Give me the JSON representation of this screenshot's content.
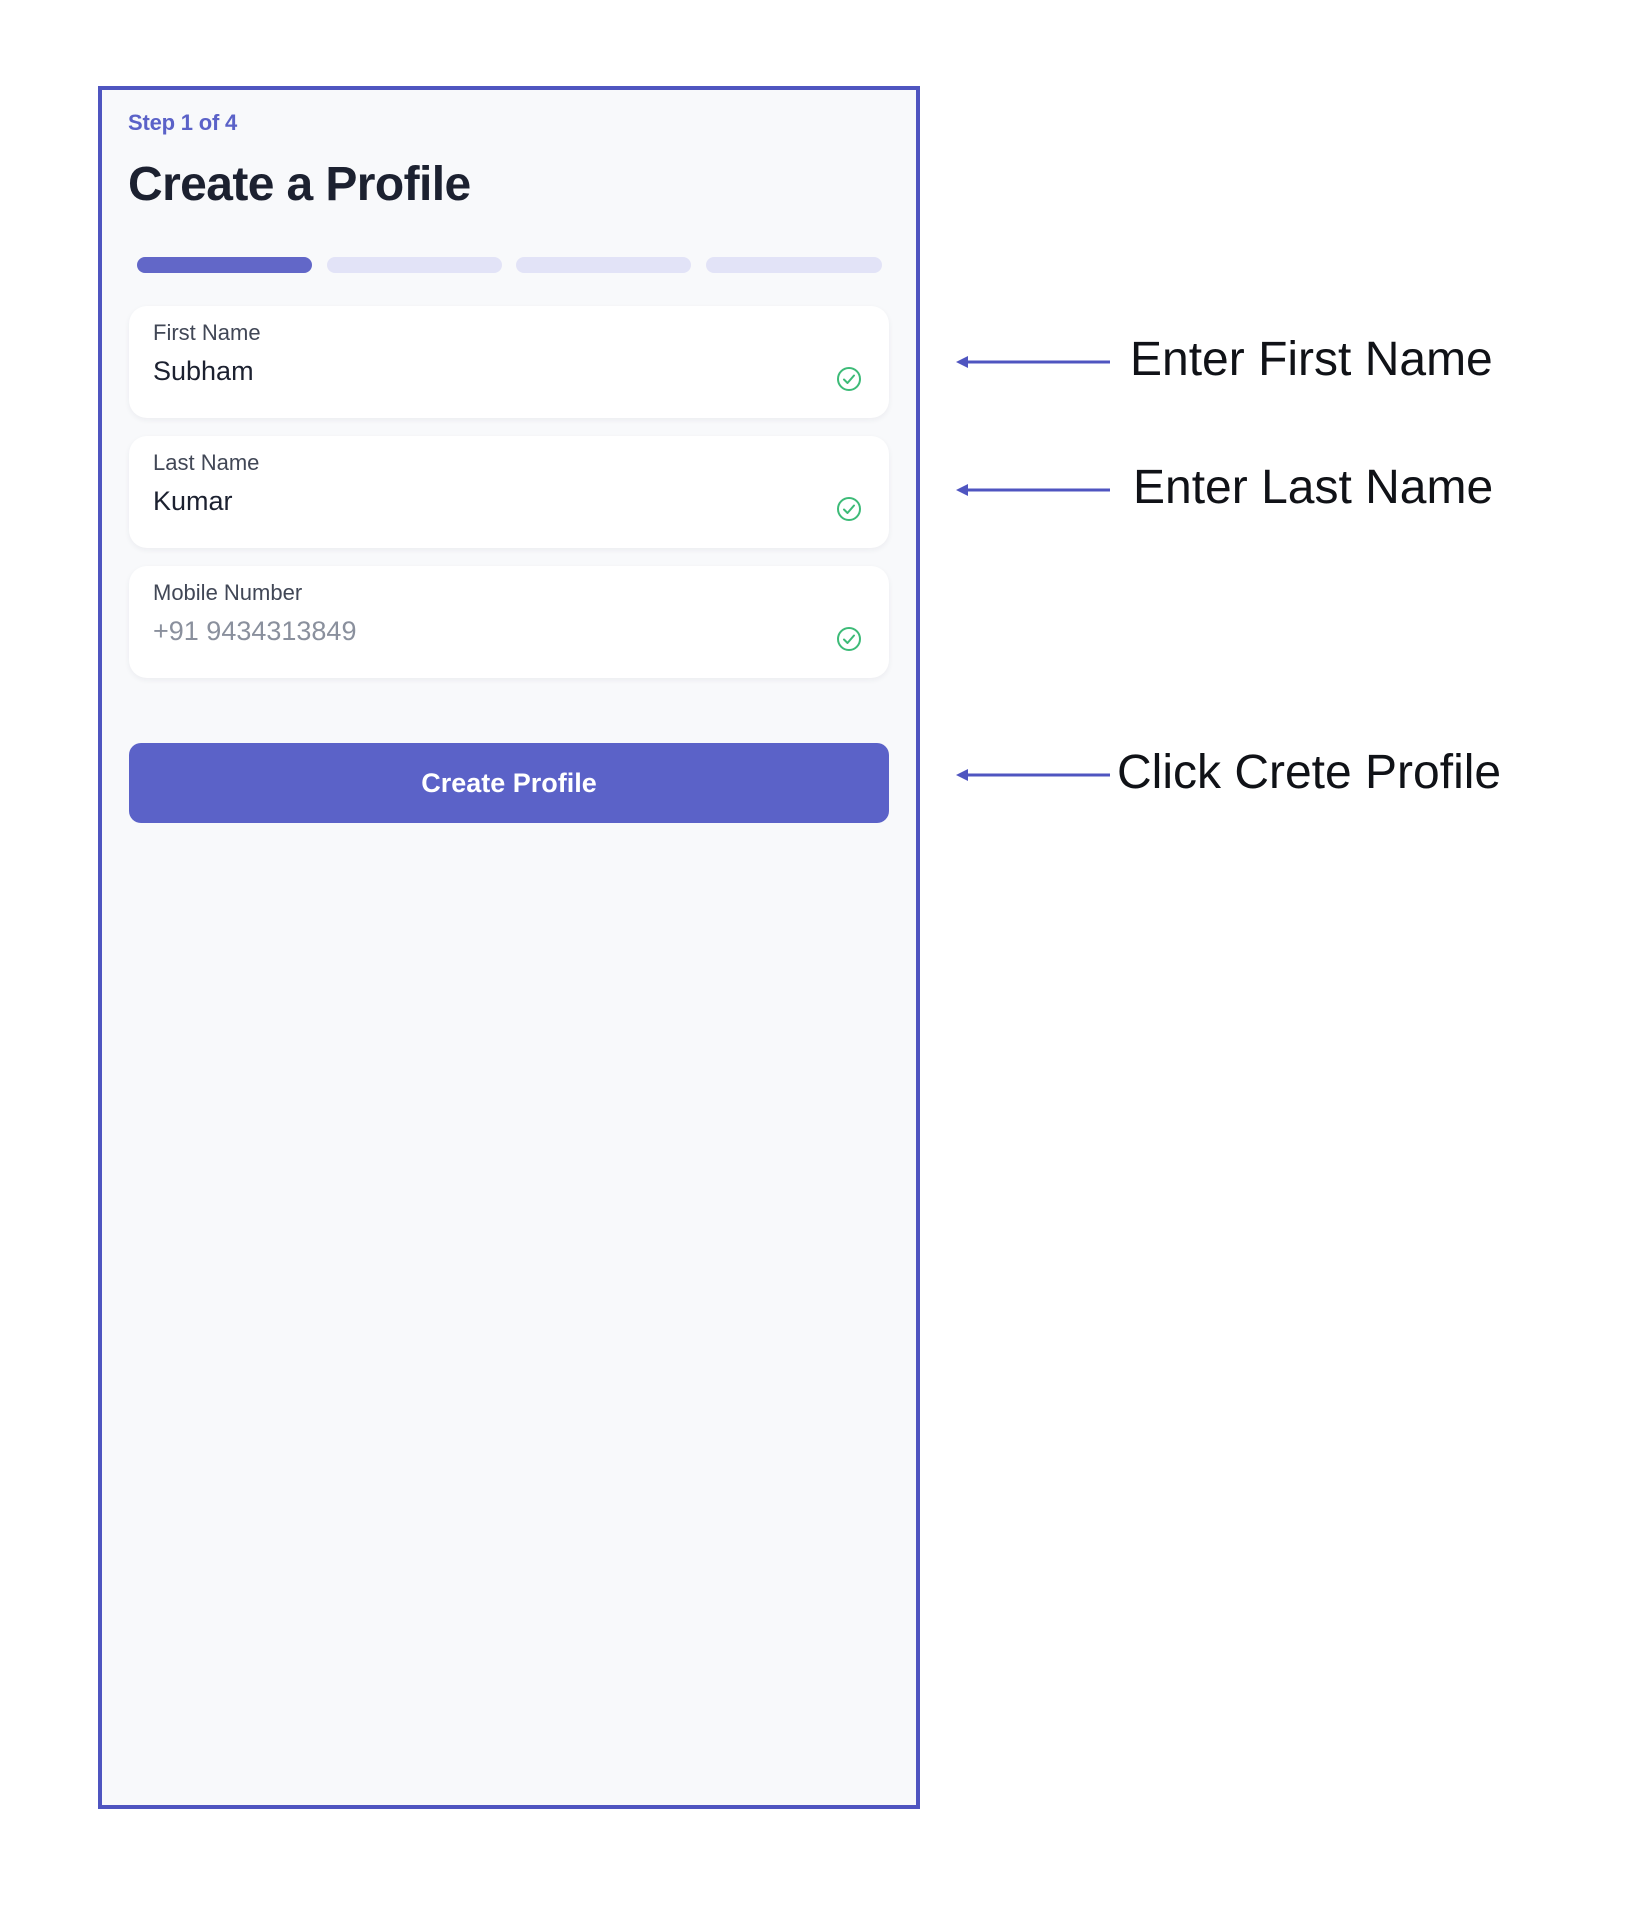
{
  "app": {
    "step_indicator": "Step 1 of 4",
    "title": "Create a Profile",
    "progress": {
      "current_step": 1,
      "total_steps": 4
    },
    "fields": [
      {
        "label": "First Name",
        "value": "Subham",
        "status_icon": "check-circle-icon"
      },
      {
        "label": "Last Name",
        "value": "Kumar",
        "status_icon": "check-circle-icon"
      },
      {
        "label": "Mobile Number",
        "value": "+91 9434313849",
        "status_icon": "check-circle-icon"
      }
    ],
    "create_button_label": "Create Profile"
  },
  "annotations": [
    {
      "text": "Enter First Name",
      "icon": "arrow-left-icon"
    },
    {
      "text": "Enter Last Name",
      "icon": "arrow-left-icon"
    },
    {
      "text": "Click Crete Profile",
      "icon": "arrow-left-icon"
    }
  ],
  "colors": {
    "accent": "#5b62c8",
    "frame_border": "#4f55c0",
    "progress_inactive": "#e2e3f7",
    "success": "#3dbb78",
    "background": "#f8f9fb",
    "title_text": "#1c2130"
  }
}
